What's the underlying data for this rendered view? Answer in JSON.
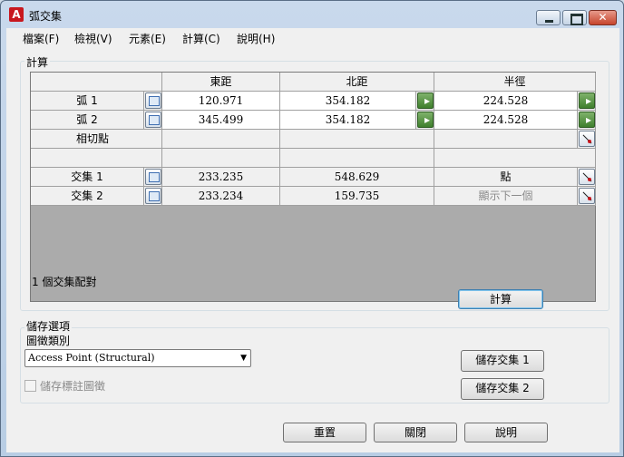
{
  "window": {
    "title": "弧交集",
    "app_icon": "A"
  },
  "menu": [
    "檔案(F)",
    "檢視(V)",
    "元素(E)",
    "計算(C)",
    "說明(H)"
  ],
  "calc_group": {
    "label": "計算"
  },
  "grid": {
    "headers": [
      "",
      "",
      "東距",
      "北距",
      "",
      "半徑",
      ""
    ],
    "rows": [
      {
        "label": "弧 1",
        "easting": "120.971",
        "northing": "354.182",
        "radius": "224.528"
      },
      {
        "label": "弧 2",
        "easting": "345.499",
        "northing": "354.182",
        "radius": "224.528"
      },
      {
        "label": "相切點",
        "easting": "",
        "northing": "",
        "radius": ""
      },
      {
        "label": "",
        "easting": "",
        "northing": "",
        "radius": ""
      },
      {
        "label": "交集 1",
        "easting": "233.235",
        "northing": "548.629",
        "radius": "點"
      },
      {
        "label": "交集 2",
        "easting": "233.234",
        "northing": "159.735",
        "radius": "顯示下一個"
      }
    ]
  },
  "status_text": "1 個交集配對",
  "calc_button": "計算",
  "save_group": {
    "label": "儲存選項",
    "symbol_label": "圖徵類別",
    "symbol_value": "Access Point (Structural)",
    "save_annotation_label": "儲存標註圖徵",
    "save_annotation_checked": false,
    "save_int1": "儲存交集 1",
    "save_int2": "儲存交集 2"
  },
  "bottom": {
    "reset": "重置",
    "close": "關閉",
    "help": "說明"
  },
  "icons": {
    "close": "close-icon",
    "minimize": "minimize-icon",
    "maximize": "maximize-icon"
  },
  "colors": {
    "app_icon": "#c8171e",
    "title_gradient": "#c9d9ec"
  }
}
